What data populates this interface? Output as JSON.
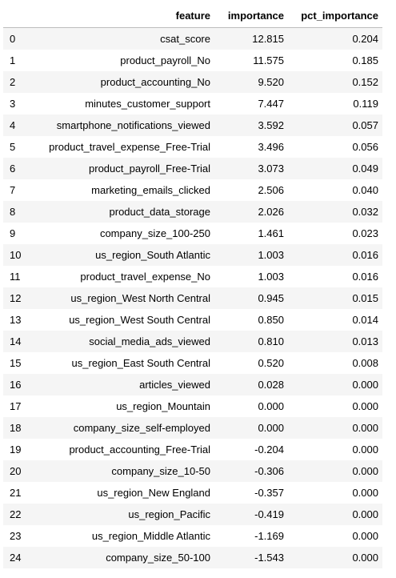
{
  "table": {
    "columns": [
      "",
      "feature",
      "importance",
      "pct_importance"
    ],
    "rows": [
      {
        "index": "0",
        "feature": "csat_score",
        "importance": "12.815",
        "pct_importance": "0.204"
      },
      {
        "index": "1",
        "feature": "product_payroll_No",
        "importance": "11.575",
        "pct_importance": "0.185"
      },
      {
        "index": "2",
        "feature": "product_accounting_No",
        "importance": "9.520",
        "pct_importance": "0.152"
      },
      {
        "index": "3",
        "feature": "minutes_customer_support",
        "importance": "7.447",
        "pct_importance": "0.119"
      },
      {
        "index": "4",
        "feature": "smartphone_notifications_viewed",
        "importance": "3.592",
        "pct_importance": "0.057"
      },
      {
        "index": "5",
        "feature": "product_travel_expense_Free-Trial",
        "importance": "3.496",
        "pct_importance": "0.056"
      },
      {
        "index": "6",
        "feature": "product_payroll_Free-Trial",
        "importance": "3.073",
        "pct_importance": "0.049"
      },
      {
        "index": "7",
        "feature": "marketing_emails_clicked",
        "importance": "2.506",
        "pct_importance": "0.040"
      },
      {
        "index": "8",
        "feature": "product_data_storage",
        "importance": "2.026",
        "pct_importance": "0.032"
      },
      {
        "index": "9",
        "feature": "company_size_100-250",
        "importance": "1.461",
        "pct_importance": "0.023"
      },
      {
        "index": "10",
        "feature": "us_region_South Atlantic",
        "importance": "1.003",
        "pct_importance": "0.016"
      },
      {
        "index": "11",
        "feature": "product_travel_expense_No",
        "importance": "1.003",
        "pct_importance": "0.016"
      },
      {
        "index": "12",
        "feature": "us_region_West North Central",
        "importance": "0.945",
        "pct_importance": "0.015"
      },
      {
        "index": "13",
        "feature": "us_region_West South Central",
        "importance": "0.850",
        "pct_importance": "0.014"
      },
      {
        "index": "14",
        "feature": "social_media_ads_viewed",
        "importance": "0.810",
        "pct_importance": "0.013"
      },
      {
        "index": "15",
        "feature": "us_region_East South Central",
        "importance": "0.520",
        "pct_importance": "0.008"
      },
      {
        "index": "16",
        "feature": "articles_viewed",
        "importance": "0.028",
        "pct_importance": "0.000"
      },
      {
        "index": "17",
        "feature": "us_region_Mountain",
        "importance": "0.000",
        "pct_importance": "0.000"
      },
      {
        "index": "18",
        "feature": "company_size_self-employed",
        "importance": "0.000",
        "pct_importance": "0.000"
      },
      {
        "index": "19",
        "feature": "product_accounting_Free-Trial",
        "importance": "-0.204",
        "pct_importance": "0.000"
      },
      {
        "index": "20",
        "feature": "company_size_10-50",
        "importance": "-0.306",
        "pct_importance": "0.000"
      },
      {
        "index": "21",
        "feature": "us_region_New England",
        "importance": "-0.357",
        "pct_importance": "0.000"
      },
      {
        "index": "22",
        "feature": "us_region_Pacific",
        "importance": "-0.419",
        "pct_importance": "0.000"
      },
      {
        "index": "23",
        "feature": "us_region_Middle Atlantic",
        "importance": "-1.169",
        "pct_importance": "0.000"
      },
      {
        "index": "24",
        "feature": "company_size_50-100",
        "importance": "-1.543",
        "pct_importance": "0.000"
      }
    ]
  },
  "colors": {
    "stripe": "#f5f5f5",
    "background": "#ffffff",
    "header_rule": "#bdbdbd"
  }
}
